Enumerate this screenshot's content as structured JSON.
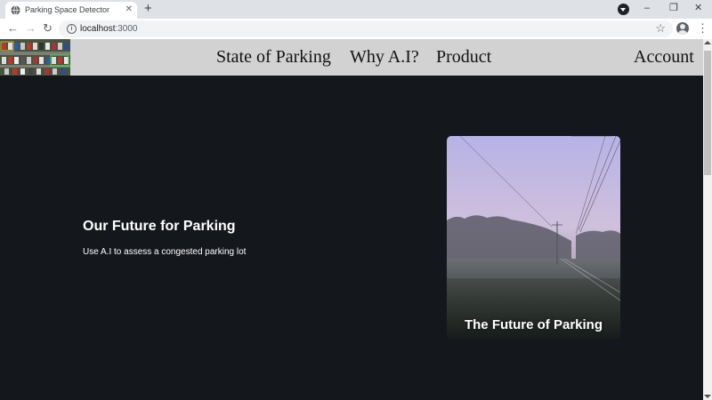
{
  "browser": {
    "tab_title": "Parking Space Detector",
    "tab_icon": "globe-icon",
    "new_tab_symbol": "+",
    "close_symbol": "✕",
    "url_host": "localhost",
    "url_port": ":3000",
    "back_symbol": "←",
    "forward_symbol": "→",
    "reload_symbol": "↻",
    "star_symbol": "☆",
    "menu_symbol": "⋮",
    "minimize_symbol": "–",
    "restore_symbol": "❐",
    "window_close_symbol": "✕"
  },
  "navbar": {
    "links": [
      "State of Parking",
      "Why A.I?",
      "Product"
    ],
    "account": "Account",
    "background": "#d3d2d3"
  },
  "hero": {
    "title": "Our Future for Parking",
    "subtitle": "Use A.I to assess a congested parking lot"
  },
  "card": {
    "caption": "The Future of Parking"
  },
  "colors": {
    "page_background": "#14171c",
    "text": "#ffffff"
  }
}
